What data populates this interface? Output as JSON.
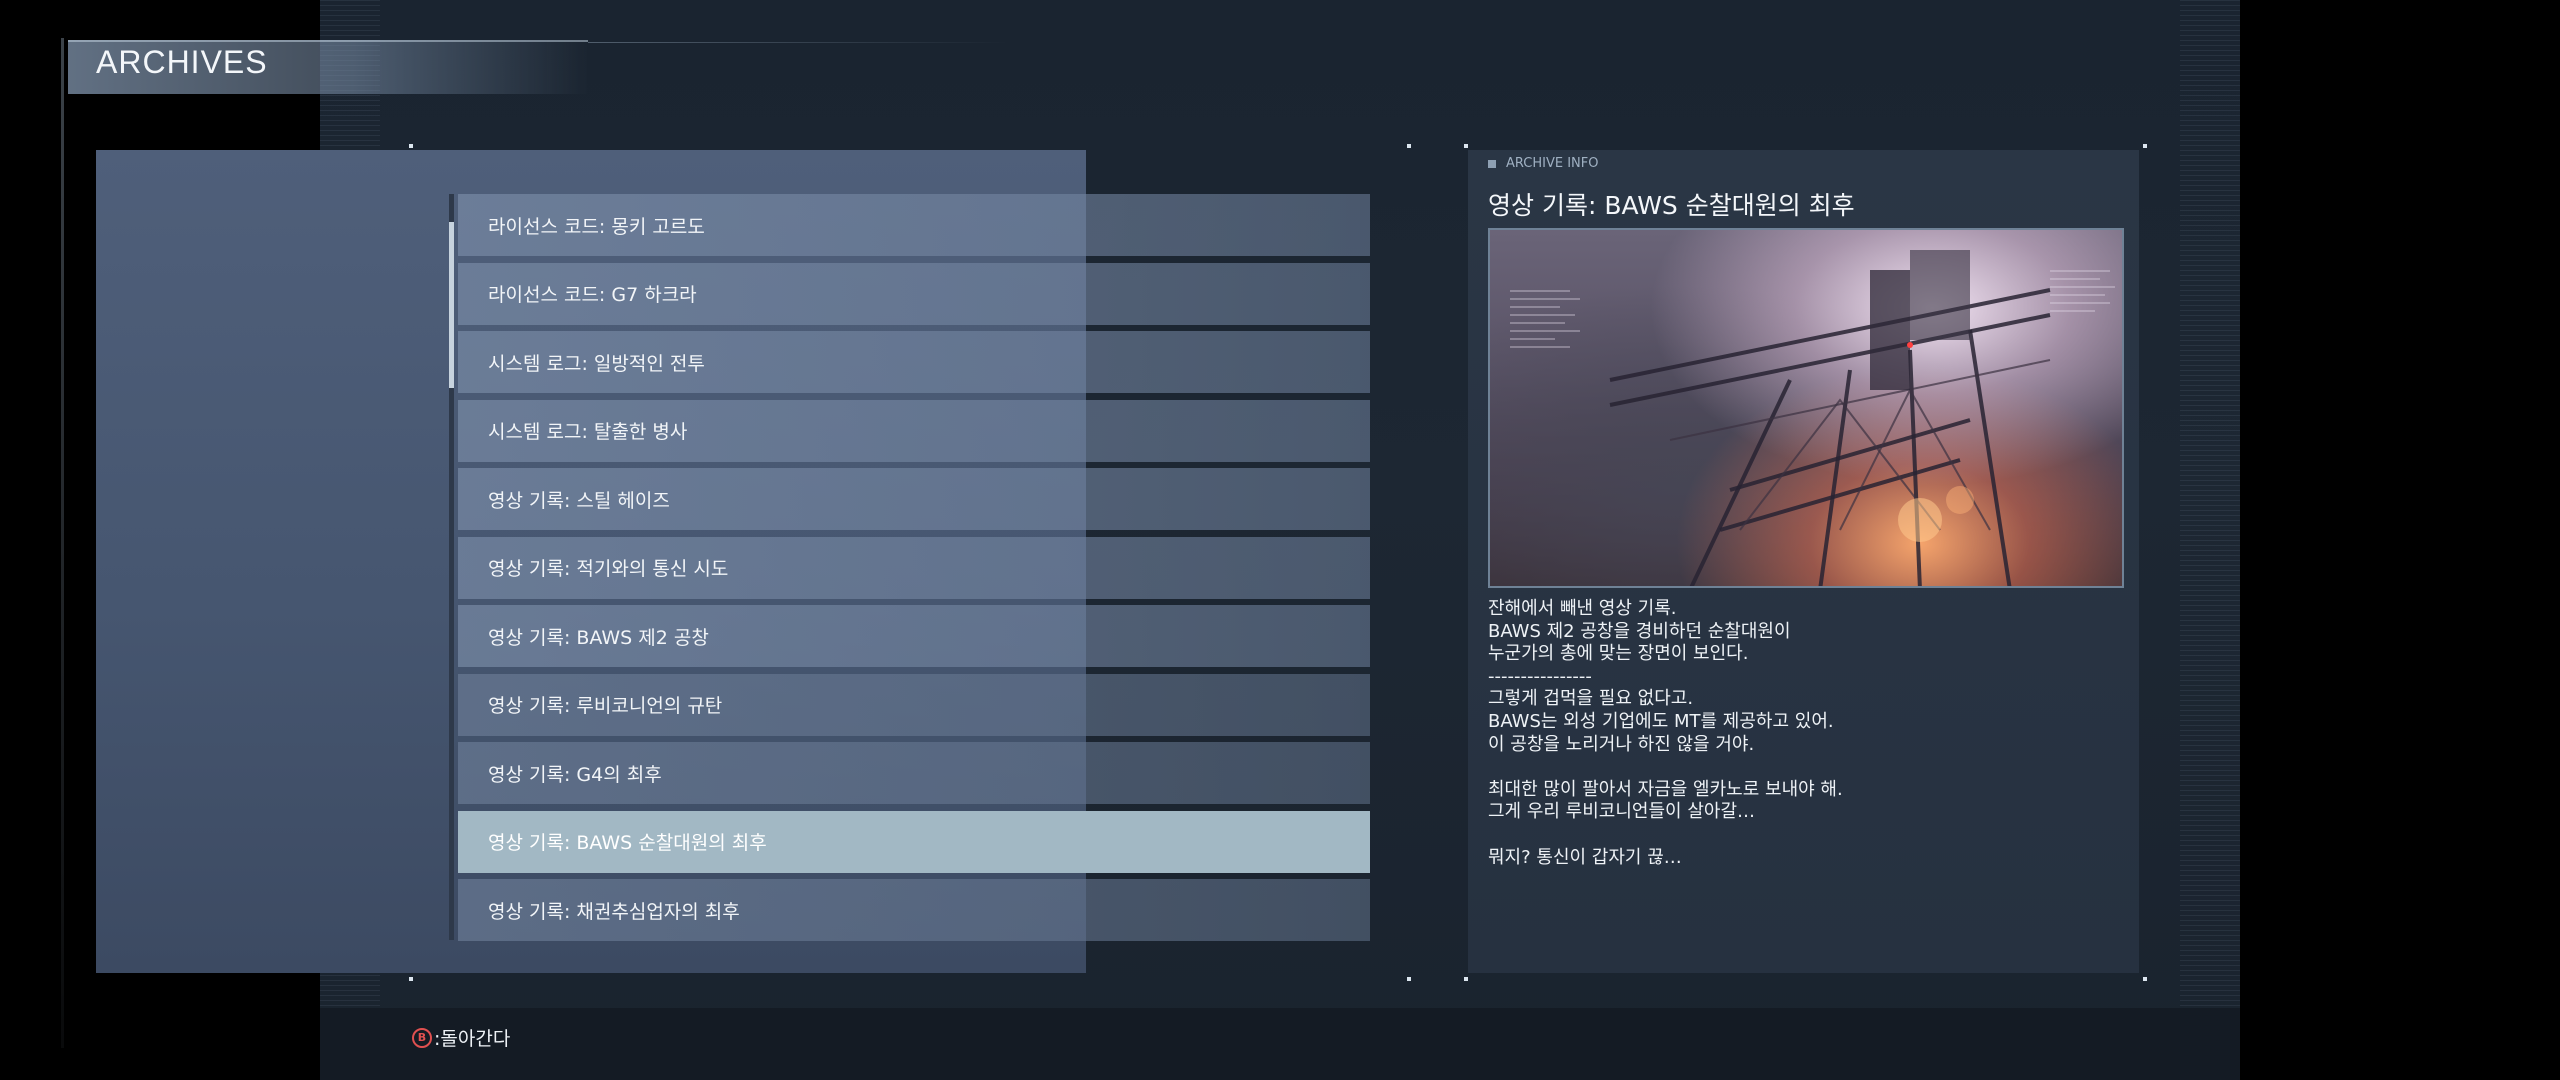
{
  "header": {
    "title": "ARCHIVES"
  },
  "archive_list": {
    "items": [
      {
        "label": "라이선스 코드: 몽키 고르도"
      },
      {
        "label": "라이선스 코드: G7 하크라"
      },
      {
        "label": "시스템 로그: 일방적인 전투"
      },
      {
        "label": "시스템 로그: 탈출한 병사"
      },
      {
        "label": "영상 기록: 스틸 헤이즈"
      },
      {
        "label": "영상 기록: 적기와의 통신 시도"
      },
      {
        "label": "영상 기록: BAWS 제2 공창"
      },
      {
        "label": "영상 기록: 루비코니언의 규탄"
      },
      {
        "label": "영상 기록: G4의 최후"
      },
      {
        "label": "영상 기록: BAWS 순찰대원의 최후"
      },
      {
        "label": "영상 기록: 채권추심업자의 최후"
      }
    ],
    "selected_index": 9
  },
  "archive_info": {
    "caption": "ARCHIVE INFO",
    "title": "영상 기록: BAWS 순찰대원의 최후",
    "body_lines": [
      "잔해에서 빼낸 영상 기록.",
      "BAWS 제2 공창을 경비하던 순찰대원이",
      "누군가의 총에 맞는 장면이 보인다.",
      "----------------",
      "그렇게 겁먹을 필요 없다고.",
      "BAWS는 외성 기업에도 MT를 제공하고 있어.",
      "이 공창을 노리거나 하진 않을 거야.",
      "",
      "최대한 많이 팔아서 자금을 엘카노로 보내야 해.",
      "그게 우리 루비코니언들이 살아갈…",
      "",
      "뭐지? 통신이 갑자기 끊…"
    ]
  },
  "footer": {
    "back_button_glyph": "B",
    "back_label": ":돌아간다"
  },
  "colors": {
    "selected_item": "#a2b8c4",
    "button_red": "#e05050"
  }
}
